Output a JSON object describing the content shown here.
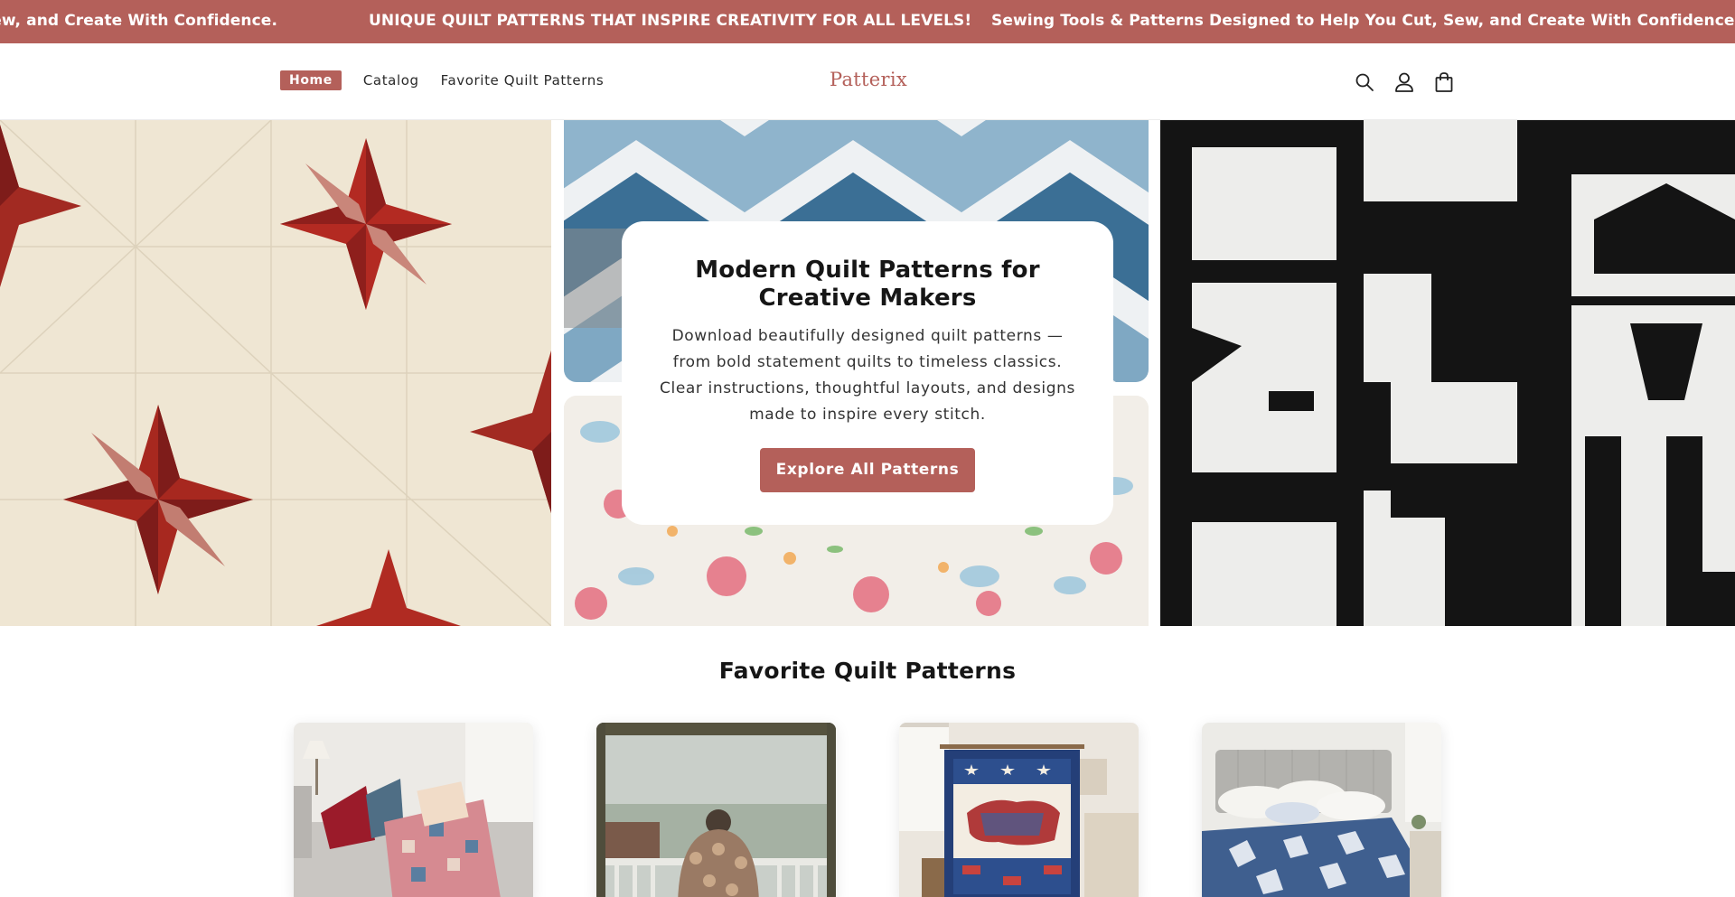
{
  "announcement": {
    "messages": [
      "Sew, and Create With Confidence.",
      "UNIQUE QUILT PATTERNS THAT INSPIRE CREATIVITY FOR ALL LEVELS!",
      "Sewing Tools & Patterns Designed to Help You Cut, Sew, and Create With Confidence."
    ]
  },
  "header": {
    "nav": [
      "Home",
      "Catalog",
      "Favorite Quilt Patterns"
    ],
    "active_nav": "Home",
    "logo": "Patterix",
    "icons": [
      "search-icon",
      "account-icon",
      "cart-icon"
    ]
  },
  "hero": {
    "title": "Modern Quilt Patterns for Creative Makers",
    "description": "Download beautifully designed quilt patterns — from bold statement quilts to timeless classics. Clear instructions, thoughtful layouts, and designs made to inspire every stitch.",
    "cta": "Explore All Patterns"
  },
  "favorites": {
    "title": "Favorite Quilt Patterns",
    "items": [
      "patchwork quilt on sofa",
      "hexagon quilt on porch",
      "patriotic map quilt",
      "blue quilt on bed"
    ]
  },
  "colors": {
    "brand": "#b4605a",
    "text": "#161616",
    "background": "#ffffff"
  }
}
